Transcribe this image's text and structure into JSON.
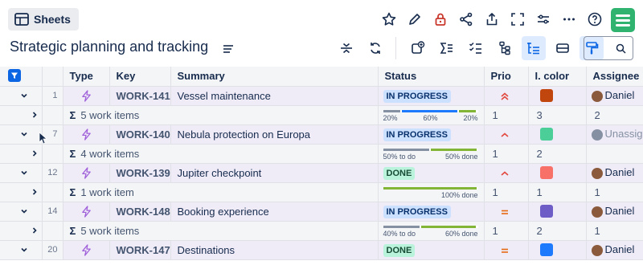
{
  "toolbar": {
    "sheets_label": "Sheets",
    "icons": [
      "star-icon",
      "edit-icon",
      "lock-icon",
      "share-icon",
      "export-icon",
      "fullscreen-icon",
      "settings-icon",
      "more-icon",
      "help-icon"
    ]
  },
  "page": {
    "title": "Strategic planning and tracking"
  },
  "tools": [
    "collapse-icon",
    "refresh-icon",
    "add-report-icon",
    "sum-icon",
    "checklist-icon",
    "hierarchy-icon",
    "tree-filter-icon",
    "row-height-icon",
    "paint-icon"
  ],
  "columns": {
    "type": "Type",
    "key": "Key",
    "summary": "Summary",
    "status": "Status",
    "prio": "Prio",
    "color": "I. color",
    "assignee": "Assignee"
  },
  "rows": [
    {
      "num": "1",
      "key": "WORK-141",
      "summary": "Vessel maintenance",
      "status": "IN PROGRESS",
      "status_type": "progress",
      "prio": "highest",
      "color": "#c1460e",
      "assignee": "Daniel",
      "child": {
        "label": "5 work items",
        "p1": "1",
        "p2": "3",
        "p3": "2",
        "segments": [
          {
            "w": 20,
            "c": "#8590a2"
          },
          {
            "w": 60,
            "c": "#1d7afc"
          },
          {
            "w": 20,
            "c": "#82b536"
          }
        ],
        "labels": [
          "20%",
          "60%",
          "20%"
        ]
      }
    },
    {
      "num": "7",
      "key": "WORK-140",
      "summary": "Nebula protection on Europa",
      "status": "IN PROGRESS",
      "status_type": "progress",
      "prio": "high",
      "color": "#4bce97",
      "assignee": "Unassigned",
      "unassigned": true,
      "child": {
        "label": "4 work items",
        "p1": "1",
        "p2": "2",
        "p3": "",
        "segments": [
          {
            "w": 50,
            "c": "#8590a2"
          },
          {
            "w": 50,
            "c": "#82b536"
          }
        ],
        "labels": [
          "50% to do",
          "50% done"
        ]
      }
    },
    {
      "num": "12",
      "key": "WORK-139",
      "summary": "Jupiter checkpoint",
      "status": "DONE",
      "status_type": "done",
      "prio": "high",
      "color": "#f87168",
      "assignee": "Daniel",
      "child": {
        "label": "1 work item",
        "p1": "1",
        "p2": "1",
        "p3": "1",
        "segments": [
          {
            "w": 100,
            "c": "#82b536"
          }
        ],
        "labels": [
          "100% done"
        ]
      }
    },
    {
      "num": "14",
      "key": "WORK-148",
      "summary": "Booking experience",
      "status": "IN PROGRESS",
      "status_type": "progress",
      "prio": "medium",
      "color": "#6e5dc6",
      "assignee": "Daniel",
      "child": {
        "label": "5 work items",
        "p1": "1",
        "p2": "2",
        "p3": "1",
        "segments": [
          {
            "w": 40,
            "c": "#8590a2"
          },
          {
            "w": 60,
            "c": "#82b536"
          }
        ],
        "labels": [
          "40% to do",
          "60% done"
        ]
      }
    },
    {
      "num": "20",
      "key": "WORK-147",
      "summary": "Destinations",
      "status": "DONE",
      "status_type": "done",
      "prio": "medium",
      "color": "#1d7afc",
      "assignee": "Daniel",
      "child": null
    }
  ],
  "sigma": "Σ"
}
